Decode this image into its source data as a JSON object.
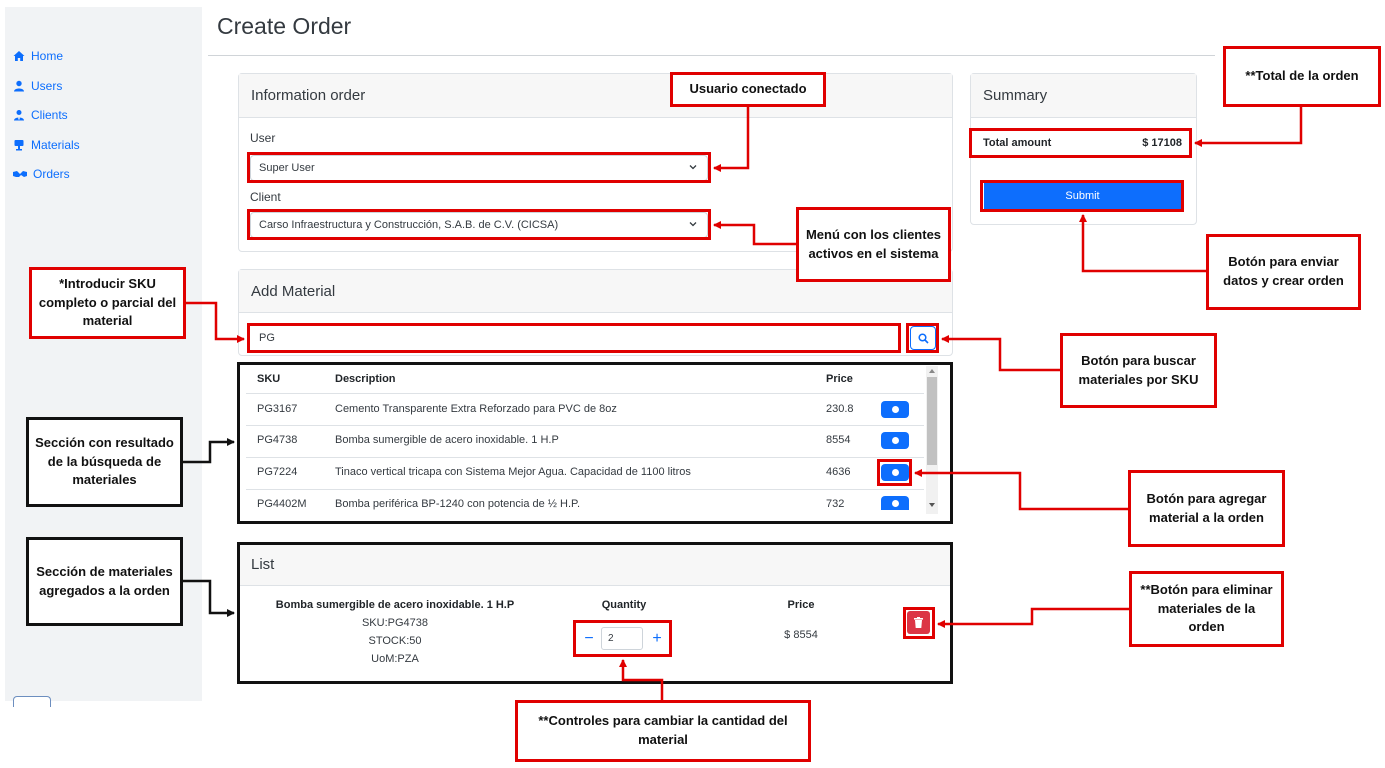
{
  "sidebar": {
    "items": [
      {
        "label": "Home",
        "icon": "home-icon"
      },
      {
        "label": "Users",
        "icon": "user-icon"
      },
      {
        "label": "Clients",
        "icon": "clients-icon"
      },
      {
        "label": "Materials",
        "icon": "materials-icon"
      },
      {
        "label": "Orders",
        "icon": "orders-icon"
      }
    ]
  },
  "header": {
    "title": "Create Order"
  },
  "information_order": {
    "title": "Information order",
    "user_label": "User",
    "user_value": "Super User",
    "client_label": "Client",
    "client_value": "Carso Infraestructura y Construcción, S.A.B. de C.V. (CICSA)"
  },
  "add_material": {
    "title": "Add Material",
    "search_value": "PG",
    "columns": {
      "sku": "SKU",
      "description": "Description",
      "price": "Price"
    },
    "rows": [
      {
        "sku": "PG3167",
        "description": "Cemento Transparente Extra Reforzado para PVC de 8oz",
        "price": "230.8"
      },
      {
        "sku": "PG4738",
        "description": "Bomba sumergible de acero inoxidable. 1 H.P",
        "price": "8554"
      },
      {
        "sku": "PG7224",
        "description": "Tinaco vertical tricapa con Sistema Mejor Agua. Capacidad de 1100 litros",
        "price": "4636"
      },
      {
        "sku": "PG4402M",
        "description": "Bomba periférica BP-1240 con potencia de ½ H.P.",
        "price": "732"
      }
    ]
  },
  "list": {
    "title": "List",
    "item": {
      "name": "Bomba sumergible de acero inoxidable. 1 H.P",
      "sku": "SKU:PG4738",
      "stock": "STOCK:50",
      "uom": "UoM:PZA",
      "quantity_label": "Quantity",
      "quantity": "2",
      "price_label": "Price",
      "price": "$ 8554"
    }
  },
  "summary": {
    "title": "Summary",
    "total_label": "Total amount",
    "total_value": "$ 17108",
    "submit_label": "Submit"
  },
  "annotations": {
    "usuario": "Usuario conectado",
    "menu_clientes": "Menú con los clientes activos en el sistema",
    "sku": "*Introducir SKU completo o parcial del material",
    "buscar": "Botón para buscar materiales por SKU",
    "resultado": "Sección con resultado de la búsqueda de materiales",
    "agregar": "Botón para agregar material a la orden",
    "agregados": "Sección de materiales agregados a la orden",
    "eliminar": "**Botón para eliminar materiales de la orden",
    "cantidad": "**Controles para cambiar la cantidad del material",
    "total": "**Total de la orden",
    "enviar": "Botón para enviar datos y crear orden"
  },
  "colors": {
    "primary": "#0d6efd",
    "danger": "#dc3545",
    "annotation_red": "#e00000"
  }
}
